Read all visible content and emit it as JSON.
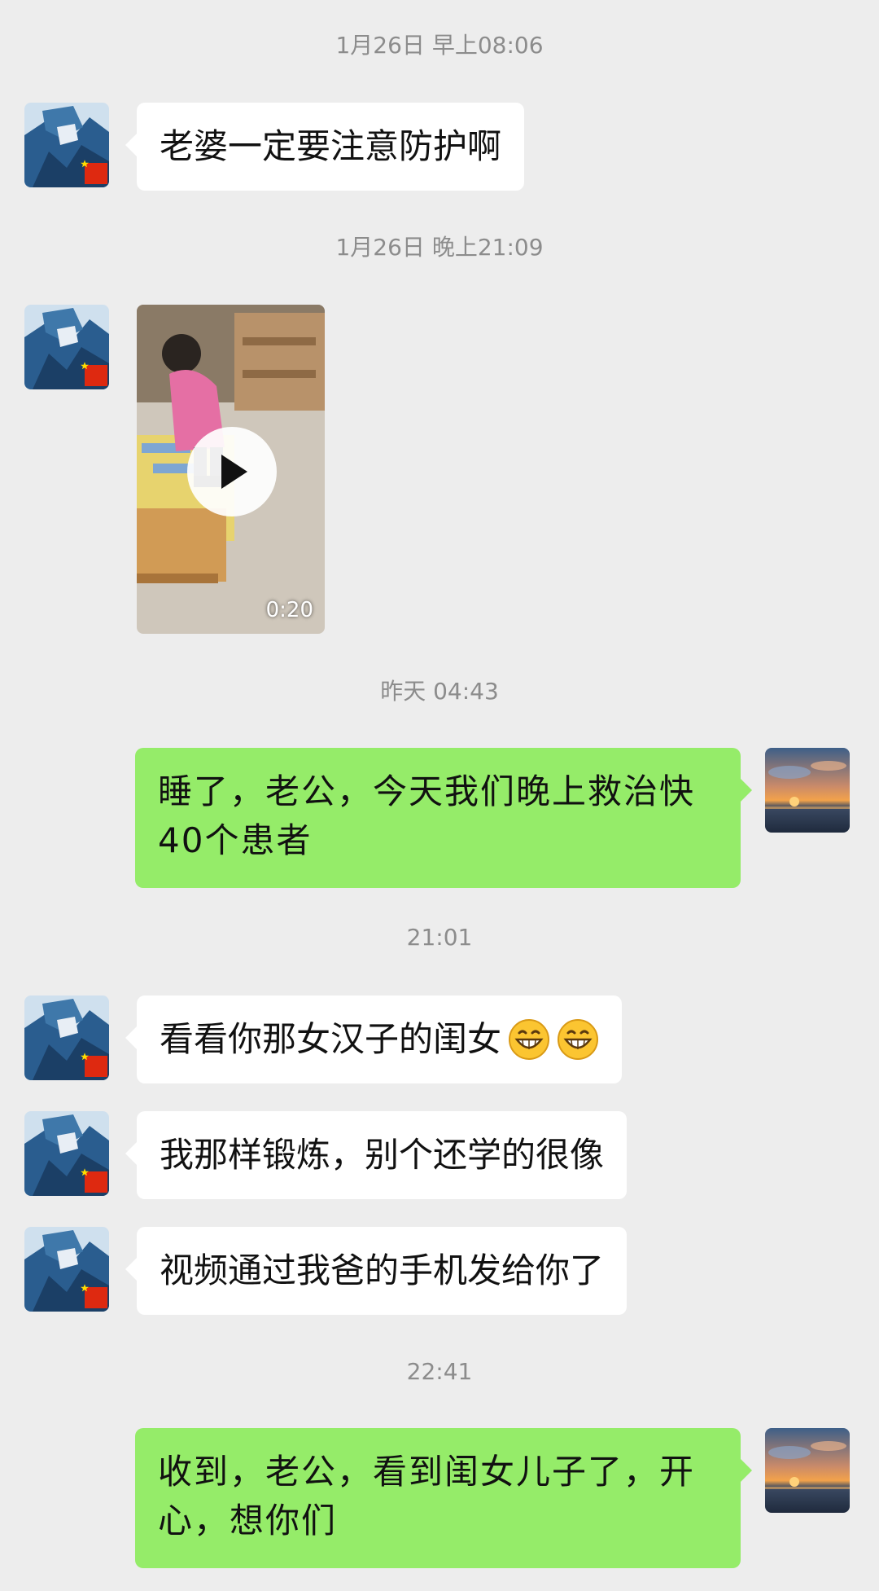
{
  "colors": {
    "background": "#ededed",
    "incoming_bubble": "#ffffff",
    "outgoing_bubble": "#95ec69",
    "timestamp_text": "#8c8c8c"
  },
  "chat": {
    "timestamps": [
      "1月26日 早上08:06",
      "1月26日 晚上21:09",
      "昨天 04:43",
      "21:01",
      "22:41"
    ],
    "messages": [
      {
        "sender": "contact",
        "type": "text",
        "text": "老婆一定要注意防护啊"
      },
      {
        "sender": "contact",
        "type": "video",
        "duration": "0:20",
        "icon": "play-icon"
      },
      {
        "sender": "self",
        "type": "text",
        "lines": [
          "睡了，老公，今天我们晚上救治快",
          "40个患者"
        ]
      },
      {
        "sender": "contact",
        "type": "text",
        "text": "看看你那女汉子的闺女",
        "emojis": [
          "grin-emoji",
          "grin-emoji"
        ]
      },
      {
        "sender": "contact",
        "type": "text",
        "text": "我那样锻炼，别个还学的很像"
      },
      {
        "sender": "contact",
        "type": "text",
        "text": "视频通过我爸的手机发给你了"
      },
      {
        "sender": "self",
        "type": "text",
        "lines": [
          "收到，老公，看到闺女儿子了，开",
          "心，想你们"
        ]
      }
    ]
  },
  "avatars": {
    "contact": {
      "icon": "contact-avatar-icon",
      "badge": "china-flag-icon"
    },
    "self": {
      "icon": "sunset-avatar-icon"
    }
  }
}
